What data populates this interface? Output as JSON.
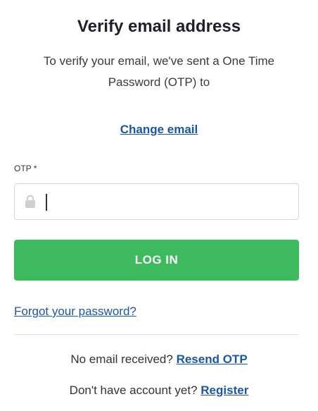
{
  "header": {
    "title": "Verify email address",
    "subtitle_line1": "To verify your email, we've sent a One Time",
    "subtitle_line2": "Password (OTP) to"
  },
  "change_email_label": "Change email",
  "otp_field": {
    "label": "OTP *",
    "value": "",
    "icon": "lock-icon"
  },
  "login_button_label": "LOG IN",
  "forgot_password_label": "Forgot your password?",
  "resend": {
    "prompt": "No email received?",
    "link_label": "Resend OTP"
  },
  "register": {
    "prompt": "Don't have account yet?",
    "link_label": "Register"
  },
  "colors": {
    "accent_green": "#3db95e",
    "link_blue": "#1a56a8"
  }
}
